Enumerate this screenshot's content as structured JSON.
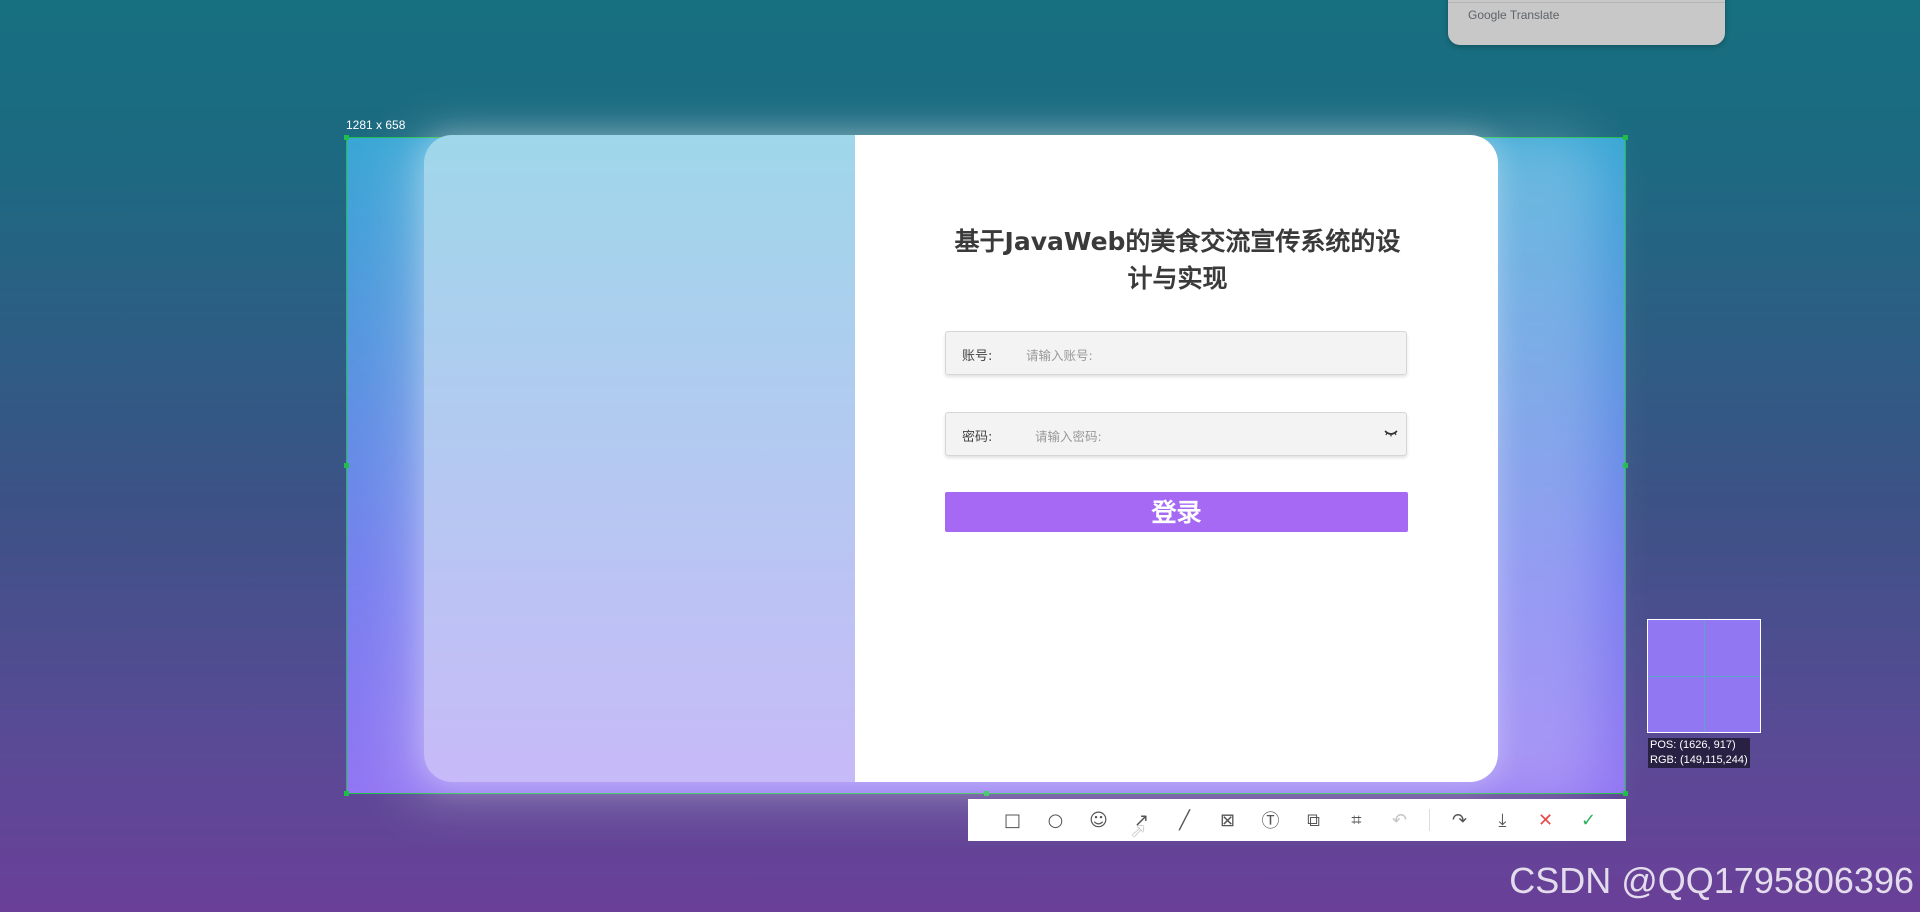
{
  "translate_panel": {
    "text": "Google Translate"
  },
  "selection": {
    "size_label": "1281 x 658"
  },
  "login": {
    "title": "基于JavaWeb的美食交流宣传系统的设计与实现",
    "account_label": "账号:",
    "account_placeholder": "请输入账号:",
    "password_label": "密码:",
    "password_placeholder": "请输入密码:",
    "password_toggle_icon": "eye-closed-icon",
    "submit_label": "登录"
  },
  "toolbar": {
    "tools": [
      {
        "name": "rectangle",
        "glyph": "□"
      },
      {
        "name": "ellipse",
        "glyph": "○"
      },
      {
        "name": "emoji",
        "glyph": "☺"
      },
      {
        "name": "arrow",
        "glyph": "↗"
      },
      {
        "name": "line",
        "glyph": "╱"
      },
      {
        "name": "mosaic",
        "glyph": "⊠"
      },
      {
        "name": "text",
        "glyph": "Ⓣ"
      },
      {
        "name": "pin",
        "glyph": "⧉"
      },
      {
        "name": "ocr",
        "glyph": "⌗"
      },
      {
        "name": "undo",
        "glyph": "↶"
      },
      {
        "name": "share",
        "glyph": "↷"
      },
      {
        "name": "save",
        "glyph": "⤓"
      },
      {
        "name": "cancel",
        "glyph": "✕"
      },
      {
        "name": "confirm",
        "glyph": "✓"
      }
    ]
  },
  "magnifier": {
    "pos_label": "POS: (1626, 917)",
    "rgb_label": "RGB: (149,115,244)",
    "color": "#9573f4"
  },
  "watermark": "CSDN @QQ1795806396",
  "colors": {
    "accent": "#a569f4",
    "selection_border": "#1fbd4a"
  }
}
